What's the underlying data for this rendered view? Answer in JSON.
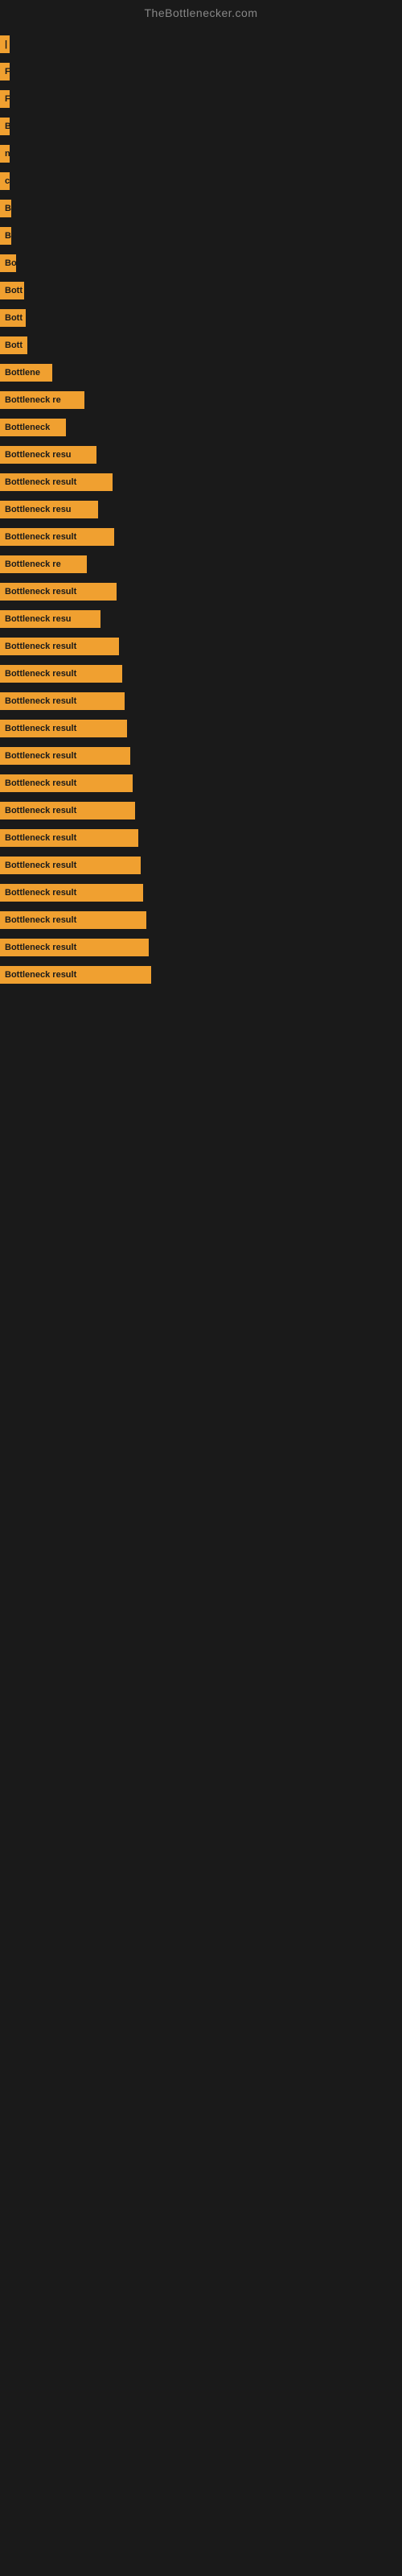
{
  "site": {
    "title": "TheBottlenecker.com"
  },
  "bars": [
    {
      "id": 1,
      "label": "|",
      "width": 8
    },
    {
      "id": 2,
      "label": "F",
      "width": 10
    },
    {
      "id": 3,
      "label": "F",
      "width": 10
    },
    {
      "id": 4,
      "label": "B",
      "width": 12
    },
    {
      "id": 5,
      "label": "n",
      "width": 12
    },
    {
      "id": 6,
      "label": "c",
      "width": 12
    },
    {
      "id": 7,
      "label": "B",
      "width": 14
    },
    {
      "id": 8,
      "label": "B",
      "width": 14
    },
    {
      "id": 9,
      "label": "Bo",
      "width": 20
    },
    {
      "id": 10,
      "label": "Bott",
      "width": 30
    },
    {
      "id": 11,
      "label": "Bott",
      "width": 32
    },
    {
      "id": 12,
      "label": "Bott",
      "width": 34
    },
    {
      "id": 13,
      "label": "Bottlene",
      "width": 65
    },
    {
      "id": 14,
      "label": "Bottleneck re",
      "width": 105
    },
    {
      "id": 15,
      "label": "Bottleneck",
      "width": 82
    },
    {
      "id": 16,
      "label": "Bottleneck resu",
      "width": 120
    },
    {
      "id": 17,
      "label": "Bottleneck result",
      "width": 140
    },
    {
      "id": 18,
      "label": "Bottleneck resu",
      "width": 122
    },
    {
      "id": 19,
      "label": "Bottleneck result",
      "width": 142
    },
    {
      "id": 20,
      "label": "Bottleneck re",
      "width": 108
    },
    {
      "id": 21,
      "label": "Bottleneck result",
      "width": 145
    },
    {
      "id": 22,
      "label": "Bottleneck resu",
      "width": 125
    },
    {
      "id": 23,
      "label": "Bottleneck result",
      "width": 148
    },
    {
      "id": 24,
      "label": "Bottleneck result",
      "width": 152
    },
    {
      "id": 25,
      "label": "Bottleneck result",
      "width": 155
    },
    {
      "id": 26,
      "label": "Bottleneck result",
      "width": 158
    },
    {
      "id": 27,
      "label": "Bottleneck result",
      "width": 162
    },
    {
      "id": 28,
      "label": "Bottleneck result",
      "width": 165
    },
    {
      "id": 29,
      "label": "Bottleneck result",
      "width": 168
    },
    {
      "id": 30,
      "label": "Bottleneck result",
      "width": 172
    },
    {
      "id": 31,
      "label": "Bottleneck result",
      "width": 175
    },
    {
      "id": 32,
      "label": "Bottleneck result",
      "width": 178
    },
    {
      "id": 33,
      "label": "Bottleneck result",
      "width": 182
    },
    {
      "id": 34,
      "label": "Bottleneck result",
      "width": 185
    },
    {
      "id": 35,
      "label": "Bottleneck result",
      "width": 188
    }
  ]
}
